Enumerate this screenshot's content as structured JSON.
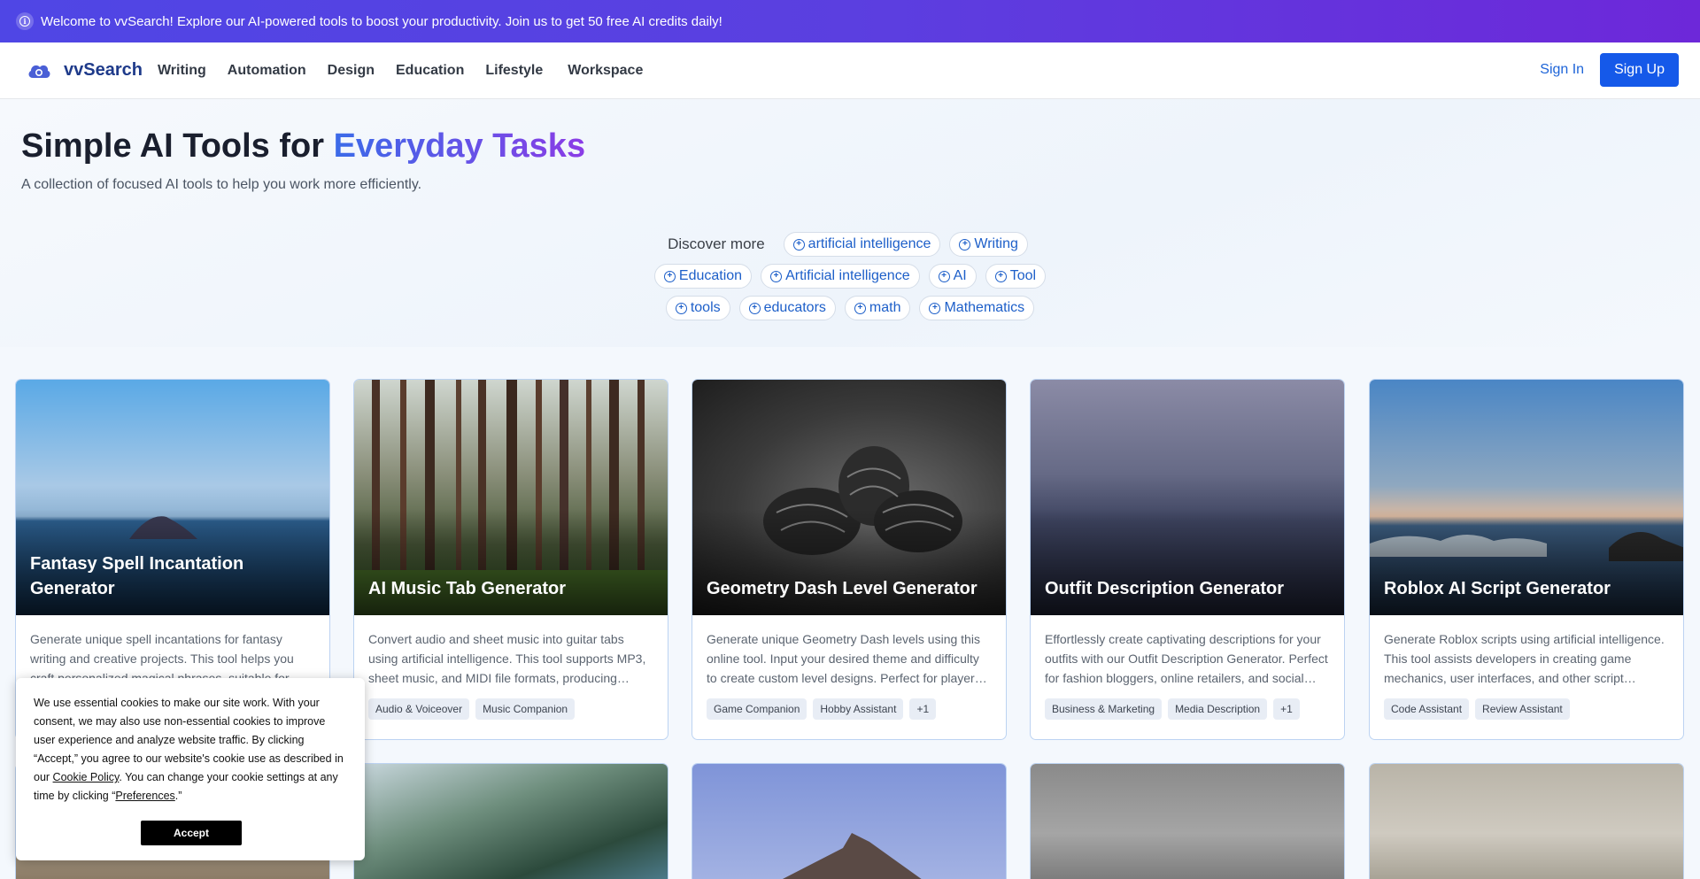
{
  "banner": {
    "text": "Welcome to vvSearch! Explore our AI-powered tools to boost your productivity. Join us to get 50 free AI credits daily!"
  },
  "nav": {
    "brand": "vvSearch",
    "links": [
      "Writing",
      "Automation",
      "Design",
      "Education",
      "Lifestyle",
      "Workspace"
    ],
    "sign_in": "Sign In",
    "sign_up": "Sign Up"
  },
  "hero": {
    "title_plain": "Simple AI Tools for ",
    "title_highlight": "Everyday Tasks",
    "subtitle": "A collection of focused AI tools to help you work more efficiently."
  },
  "discover": {
    "label": "Discover more",
    "row1": [
      "artificial intelligence",
      "Writing"
    ],
    "row2": [
      "Education",
      "Artificial intelligence",
      "AI",
      "Tool"
    ],
    "row3": [
      "tools",
      "educators",
      "math",
      "Mathematics"
    ]
  },
  "cards": [
    {
      "title": "Fantasy Spell Incantation Generator",
      "description": "Generate unique spell incantations for fantasy writing and creative projects. This tool helps you craft personalized magical phrases, suitable for…",
      "chips": []
    },
    {
      "title": "AI Music Tab Generator",
      "description": "Convert audio and sheet music into guitar tabs using artificial intelligence. This tool supports MP3, sheet music, and MIDI file formats, producing…",
      "chips": [
        "Audio & Voiceover",
        "Music Companion"
      ]
    },
    {
      "title": "Geometry Dash Level Generator",
      "description": "Generate unique Geometry Dash levels using this online tool. Input your desired theme and difficulty to create custom level designs. Perfect for player…",
      "chips": [
        "Game Companion",
        "Hobby Assistant",
        "+1"
      ]
    },
    {
      "title": "Outfit Description Generator",
      "description": "Effortlessly create captivating descriptions for your outfits with our Outfit Description Generator. Perfect for fashion bloggers, online retailers, and social…",
      "chips": [
        "Business & Marketing",
        "Media Description",
        "+1"
      ]
    },
    {
      "title": "Roblox AI Script Generator",
      "description": "Generate Roblox scripts using artificial intelligence. This tool assists developers in creating game mechanics, user interfaces, and other script…",
      "chips": [
        "Code Assistant",
        "Review Assistant"
      ]
    }
  ],
  "cookie": {
    "text_1": "We use essential cookies to make our site work. With your consent, we may also use non-essential cookies to improve user experience and analyze website traffic. By clicking “Accept,” you agree to our website's cookie use as described in our ",
    "link_policy": "Cookie Policy",
    "text_2": ". You can change your cookie settings at any time by clicking “",
    "link_prefs": "Preferences",
    "text_3": ".”",
    "accept": "Accept"
  },
  "colors": {
    "brand_blue": "#1559e9",
    "banner_start": "#4f46e5",
    "banner_end": "#6d28d9",
    "highlight_start": "#3b6be8",
    "highlight_end": "#8b3ce6"
  }
}
